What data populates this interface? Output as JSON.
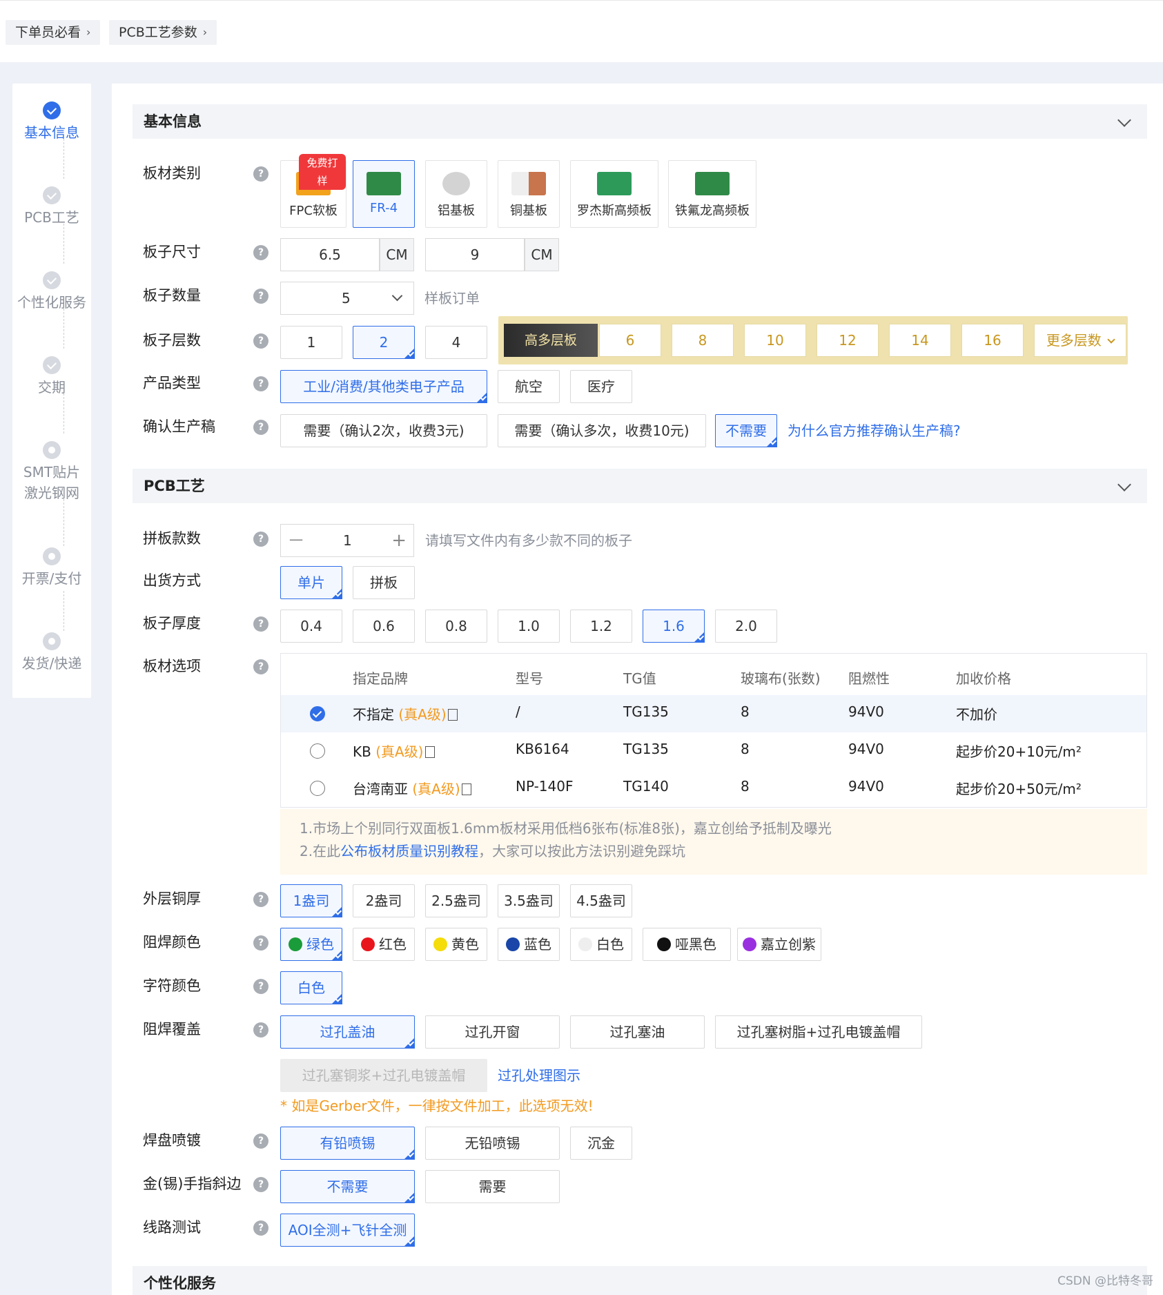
{
  "breadcrumb": [
    {
      "label": "下单员必看"
    },
    {
      "label": "PCB工艺参数"
    }
  ],
  "steps": [
    {
      "label": "基本信息",
      "state": "active"
    },
    {
      "label": "PCB工艺",
      "state": "done"
    },
    {
      "label": "个性化服务",
      "state": "done"
    },
    {
      "label": "交期",
      "state": "done"
    },
    {
      "label": "SMT贴片",
      "label2": "激光钢网",
      "state": "pending"
    },
    {
      "label": "开票/支付",
      "state": "pending"
    },
    {
      "label": "发货/快递",
      "state": "pending"
    }
  ],
  "sections": {
    "basic": "基本信息",
    "pcb": "PCB工艺",
    "personal": "个性化服务"
  },
  "help_glyph": "?",
  "labels": {
    "material": "板材类别",
    "size": "板子尺寸",
    "quantity": "板子数量",
    "layers": "板子层数",
    "product_type": "产品类型",
    "confirm": "确认生产稿",
    "panel_count": "拼板款数",
    "ship_mode": "出货方式",
    "thickness": "板子厚度",
    "board_opts": "板材选项",
    "copper": "外层铜厚",
    "mask_color": "阻焊颜色",
    "silk_color": "字符颜色",
    "mask_cover": "阻焊覆盖",
    "surface": "焊盘喷镀",
    "gold_finger": "金(锡)手指斜边",
    "test": "线路测试"
  },
  "materials": [
    {
      "label": "FPC软板",
      "badge": "免费打样",
      "icon_color": "#f2a21b"
    },
    {
      "label": "FR-4",
      "selected": true,
      "icon_color": "#2f8a47"
    },
    {
      "label": "铝基板",
      "icon_color": "#c9c9c9"
    },
    {
      "label": "铜基板",
      "icon_color": "#c8744c"
    },
    {
      "label": "罗杰斯高频板",
      "icon_color": "#2d9a5a"
    },
    {
      "label": "铁氟龙高频板",
      "icon_color": "#2f8a47"
    }
  ],
  "size": {
    "width": "6.5",
    "height": "9",
    "unit": "CM"
  },
  "quantity": {
    "value": "5",
    "hint": "样板订单"
  },
  "layers": {
    "basic": [
      "1",
      "2",
      "4"
    ],
    "selected": "2",
    "premium_tag": "高多层板",
    "premium": [
      "6",
      "8",
      "10",
      "12",
      "14",
      "16"
    ],
    "more": "更多层数"
  },
  "product_types": [
    "工业/消费/其他类电子产品",
    "航空",
    "医疗"
  ],
  "confirm_opts": [
    "需要（确认2次，收费3元)",
    "需要（确认多次，收费10元)",
    "不需要"
  ],
  "confirm_link": "为什么官方推荐确认生产稿?",
  "panel": {
    "minus": "一",
    "value": "1",
    "plus": "+",
    "hint": "请填写文件内有多少款不同的板子"
  },
  "ship_opts": [
    "单片",
    "拼板"
  ],
  "thickness_opts": [
    "0.4",
    "0.6",
    "0.8",
    "1.0",
    "1.2",
    "1.6",
    "2.0"
  ],
  "board_table": {
    "headers": [
      "指定品牌",
      "型号",
      "TG值",
      "玻璃布(张数)",
      "阻燃性",
      "加收价格"
    ],
    "rows": [
      {
        "brand": "不指定",
        "grade": "(真A级)",
        "model": "/",
        "tg": "TG135",
        "glass": "8",
        "flame": "94V0",
        "price": "不加价",
        "selected": true
      },
      {
        "brand": "KB",
        "grade": "(真A级)",
        "model": "KB6164",
        "tg": "TG135",
        "glass": "8",
        "flame": "94V0",
        "price": "起步价20+10元/m²"
      },
      {
        "brand": "台湾南亚",
        "grade": "(真A级)",
        "model": "NP-140F",
        "tg": "TG140",
        "glass": "8",
        "flame": "94V0",
        "price": "起步价20+50元/m²"
      }
    ]
  },
  "notes": {
    "line1": "1.市场上个别同行双面板1.6mm板材采用低档6张布(标准8张)，嘉立创给予抵制及曝光",
    "line2_pre": "2.在此",
    "line2_link": "公布板材质量识别教程",
    "line2_post": "，大家可以按此方法识别避免踩坑"
  },
  "copper_opts": [
    "1盎司",
    "2盎司",
    "2.5盎司",
    "3.5盎司",
    "4.5盎司"
  ],
  "mask_colors": [
    {
      "label": "绿色",
      "color": "#1a9c3a",
      "selected": true
    },
    {
      "label": "红色",
      "color": "#e8161c"
    },
    {
      "label": "黄色",
      "color": "#f5dc0b"
    },
    {
      "label": "蓝色",
      "color": "#1946a8"
    },
    {
      "label": "白色",
      "color": "#eeeeee"
    },
    {
      "label": "哑黑色",
      "color": "#111111"
    },
    {
      "label": "嘉立创紫",
      "color": "#9a2fe0"
    }
  ],
  "silk_opts": [
    "白色"
  ],
  "cover_opts": [
    "过孔盖油",
    "过孔开窗",
    "过孔塞油",
    "过孔塞树脂+过孔电镀盖帽"
  ],
  "cover_disabled": "过孔塞铜浆+过孔电镀盖帽",
  "cover_link": "过孔处理图示",
  "cover_warn": "* 如是Gerber文件，一律按文件加工，此选项无效!",
  "surface_opts": [
    "有铅喷锡",
    "无铅喷锡",
    "沉金"
  ],
  "finger_opts": [
    "不需要",
    "需要"
  ],
  "test_opts": [
    "AOI全测+飞针全测"
  ],
  "watermark": "CSDN @比特冬哥"
}
